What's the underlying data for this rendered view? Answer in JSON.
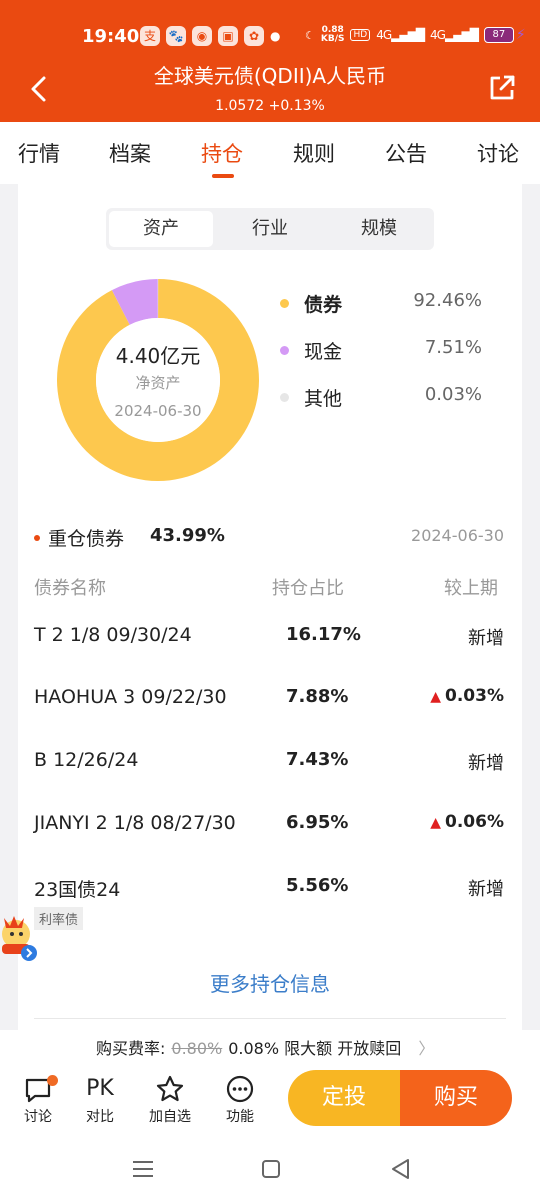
{
  "status_bar": {
    "time": "19:40",
    "net_speed_value": "0.88",
    "net_speed_unit": "KB/S",
    "hd_badge": "HD",
    "signal1": "4G",
    "signal2": "4G",
    "battery": "87"
  },
  "header": {
    "title": "全球美元债(QDII)A人民币",
    "nav_change": "1.0572 +0.13%"
  },
  "tabs": [
    "行情",
    "档案",
    "持仓",
    "规则",
    "公告",
    "讨论"
  ],
  "active_tab": "持仓",
  "segment": {
    "options": [
      "资产",
      "行业",
      "规模"
    ],
    "active": "资产"
  },
  "asset_allocation": {
    "net_assets": "4.40亿元",
    "net_assets_label": "净资产",
    "date": "2024-06-30",
    "items": [
      {
        "name": "债券",
        "pct": "92.46%",
        "value": 92.46,
        "color": "#fdc84e"
      },
      {
        "name": "现金",
        "pct": "7.51%",
        "value": 7.51,
        "color": "#d49af5"
      },
      {
        "name": "其他",
        "pct": "0.03%",
        "value": 0.03,
        "color": "#e6e6e6"
      }
    ]
  },
  "holdings": {
    "title": "重仓债券",
    "total_pct": "43.99%",
    "date": "2024-06-30",
    "columns": [
      "债券名称",
      "持仓占比",
      "较上期"
    ],
    "rows": [
      {
        "name": "T 2 1/8 09/30/24",
        "pct": "16.17%",
        "change": "新增",
        "up": false,
        "tag": ""
      },
      {
        "name": "HAOHUA 3 09/22/30",
        "pct": "7.88%",
        "change": "0.03%",
        "up": true,
        "tag": ""
      },
      {
        "name": "B 12/26/24",
        "pct": "7.43%",
        "change": "新增",
        "up": false,
        "tag": ""
      },
      {
        "name": "JIANYI 2 1/8 08/27/30",
        "pct": "6.95%",
        "change": "0.06%",
        "up": true,
        "tag": ""
      },
      {
        "name": "23国债24",
        "pct": "5.56%",
        "change": "新增",
        "up": false,
        "tag": "利率债"
      }
    ],
    "more_label": "更多持仓信息"
  },
  "fee": {
    "label": "购买费率:",
    "original": "0.80%",
    "current": "0.08%",
    "limit": "限大额",
    "status": "开放赎回"
  },
  "bottom_bar": {
    "discuss": "讨论",
    "compare_icon": "PK",
    "compare": "对比",
    "watchlist": "加自选",
    "functions": "功能",
    "dingtou": "定投",
    "buy": "购买"
  },
  "colors": {
    "brand": "#ea4a11",
    "link": "#3b7dc9",
    "up": "#e02020",
    "dingtou": "#f8b623",
    "buy": "#f4631b"
  }
}
